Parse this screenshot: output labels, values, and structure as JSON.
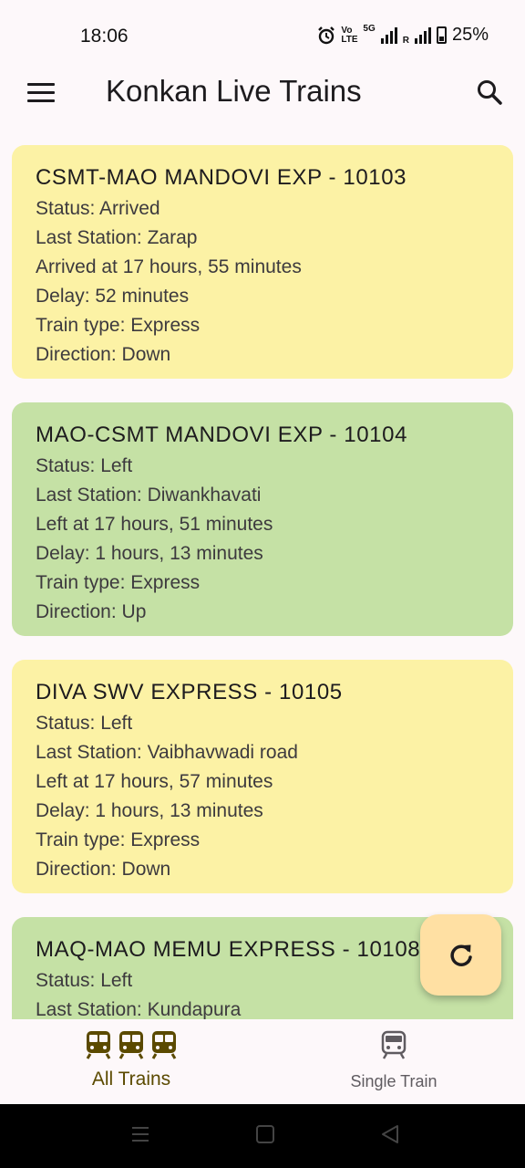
{
  "status_bar": {
    "time": "18:06",
    "volte": "Vo LTE",
    "net_5g": "5G",
    "roaming": "R",
    "battery": "25%",
    "icons": [
      "alarm-icon",
      "signal-icon",
      "battery-icon"
    ]
  },
  "app_bar": {
    "title": "Konkan Live Trains",
    "menu_icon": "menu-icon",
    "search_icon": "search-icon"
  },
  "trains": [
    {
      "title": "CSMT-MAO MANDOVI EXP - 10103",
      "status": "Status: Arrived",
      "last_station": "Last Station: Zarap",
      "time": "Arrived at 17 hours, 55 minutes",
      "delay": "Delay: 52 minutes",
      "train_type": "Train type: Express",
      "direction": "Direction: Down",
      "color": "#fcf2a5"
    },
    {
      "title": "MAO-CSMT MANDOVI EXP - 10104",
      "status": "Status: Left",
      "last_station": "Last Station: Diwankhavati",
      "time": "Left at 17 hours, 51 minutes",
      "delay": "Delay: 1 hours, 13 minutes",
      "train_type": "Train type: Express",
      "direction": "Direction: Up",
      "color": "#c5e1a5"
    },
    {
      "title": "DIVA SWV EXPRESS - 10105",
      "status": "Status: Left",
      "last_station": "Last Station: Vaibhavwadi road",
      "time": "Left at 17 hours, 57 minutes",
      "delay": "Delay: 1 hours, 13 minutes",
      "train_type": "Train type: Express",
      "direction": "Direction: Down",
      "color": "#fcf2a5"
    },
    {
      "title": "MAQ-MAO MEMU EXPRESS - 10108",
      "status": "Status: Left",
      "last_station": "Last Station: Kundapura",
      "color": "#c5e1a5"
    }
  ],
  "fab": {
    "icon": "refresh-icon"
  },
  "bottom_nav": {
    "items": [
      {
        "label": "All Trains",
        "icon": "trains-icon",
        "selected": true
      },
      {
        "label": "Single Train",
        "icon": "train-icon",
        "selected": false
      }
    ]
  },
  "system_nav": {
    "icons": [
      "recents-icon",
      "home-icon",
      "back-icon"
    ]
  },
  "colors": {
    "background": "#fdf8fa",
    "card_yellow": "#fcf2a5",
    "card_green": "#c5e1a5",
    "fab": "#ffe0a3",
    "nav_selected": "#5b4a00",
    "nav_unselected": "#5f5b60"
  }
}
